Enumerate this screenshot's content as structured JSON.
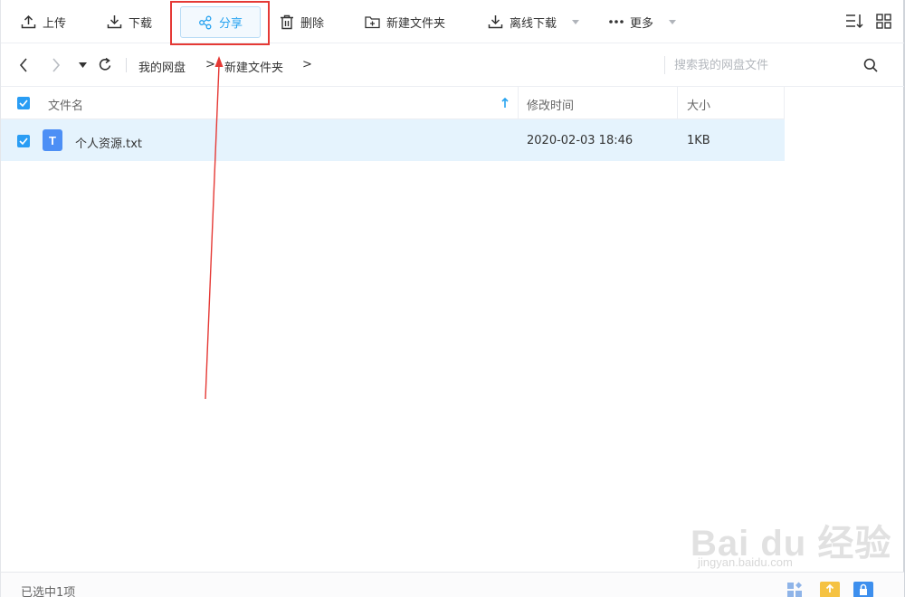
{
  "toolbar": {
    "upload_label": "上传",
    "download_label": "下载",
    "share_label": "分享",
    "delete_label": "删除",
    "new_folder_label": "新建文件夹",
    "offline_download_label": "离线下载",
    "more_label": "更多"
  },
  "nav": {
    "breadcrumb": [
      "我的网盘",
      "新建文件夹"
    ],
    "crumb_separator": ">"
  },
  "search": {
    "placeholder": "搜索我的网盘文件"
  },
  "table": {
    "columns": [
      "文件名",
      "修改时间",
      "大小"
    ],
    "rows": [
      {
        "name": "个人资源.txt",
        "modified": "2020-02-03 18:46",
        "size": "1KB",
        "icon_letter": "T",
        "selected": true
      }
    ]
  },
  "status": {
    "selected_text": "已选中1项"
  },
  "watermark": {
    "logo": "Bai du 经验",
    "url": "jingyan.baidu.com"
  },
  "colors": {
    "accent": "#27a3f0",
    "annotation": "#e53935",
    "row_selected": "#e5f3fd"
  }
}
